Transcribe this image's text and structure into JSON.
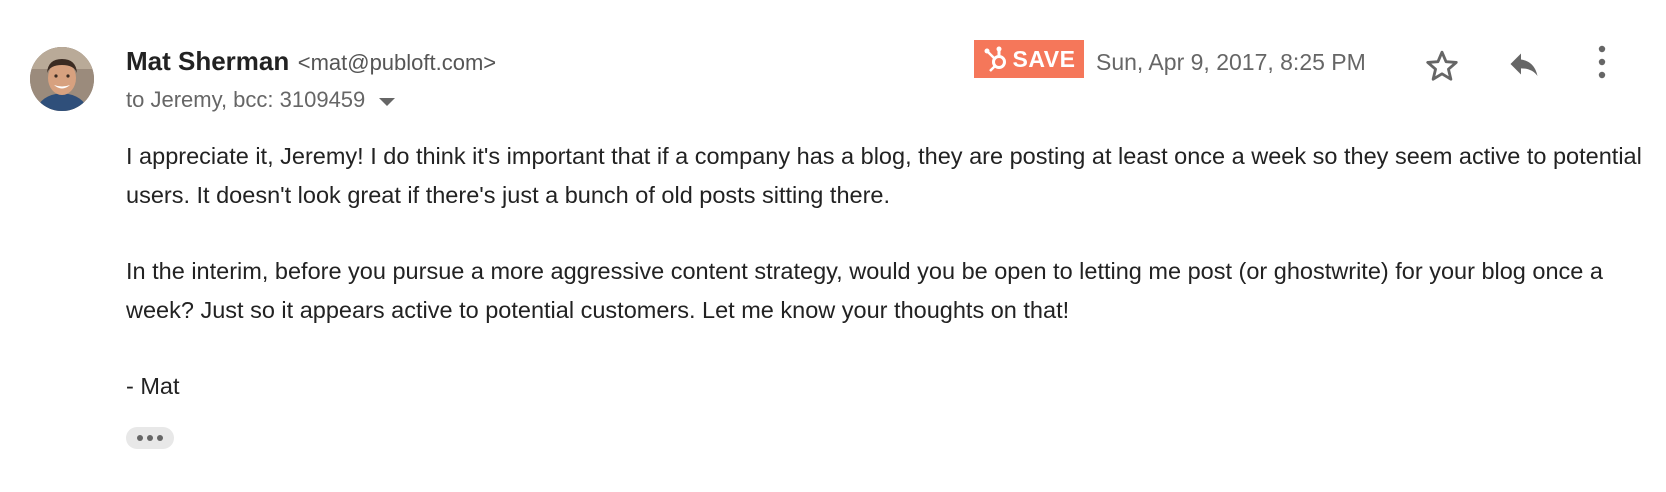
{
  "sender": {
    "name": "Mat Sherman",
    "email": "<mat@publoft.com>"
  },
  "recipients": "to Jeremy, bcc: 3109459",
  "hubspot": {
    "save_label": "SAVE",
    "color": "#f5775a"
  },
  "timestamp": "Sun, Apr 9, 2017, 8:25 PM",
  "actions": {
    "star_icon": "star-outline-icon",
    "reply_icon": "reply-icon",
    "more_icon": "more-vertical-icon"
  },
  "body": {
    "paragraph1": "I appreciate it, Jeremy! I do think it's important that if a company has a blog, they are posting at least once a week so they seem active to potential users. It doesn't look great if there's just a bunch of old posts sitting there.",
    "paragraph2": "In the interim, before you pursue a more aggressive content strategy, would you be open to letting me post (or ghostwrite) for your blog once a week? Just so it appears active to potential customers. Let me know your thoughts on that!",
    "signature": "- Mat"
  }
}
